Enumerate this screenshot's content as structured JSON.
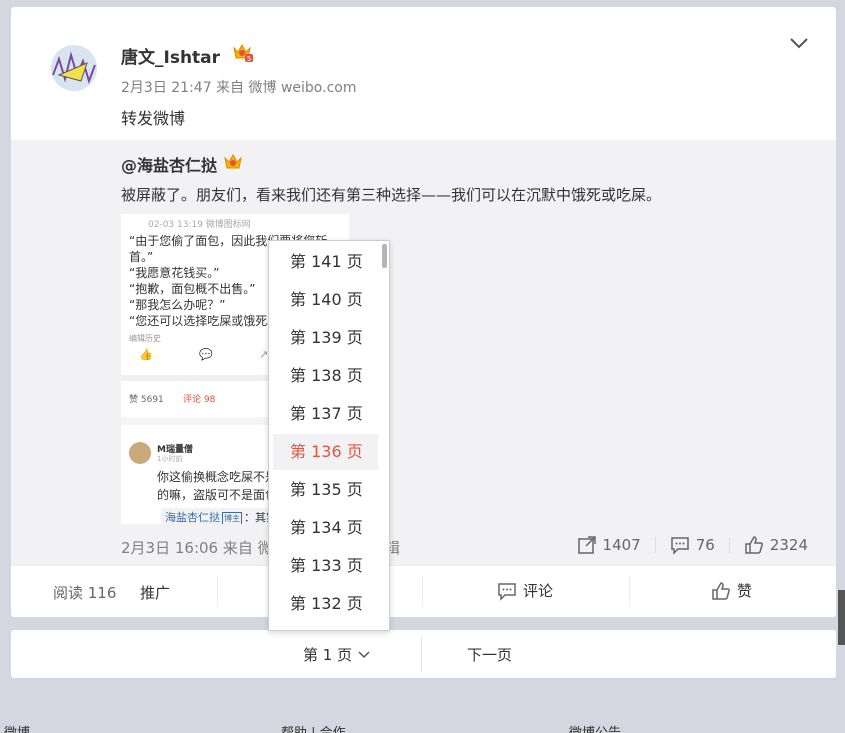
{
  "post": {
    "username": "唐文_Ishtar",
    "meta": "2月3日 21:47 来自 微博 weibo.com",
    "text": "转发微博"
  },
  "repost": {
    "username": "@海盐杏仁挞",
    "text": "被屏蔽了。朋友们，看来我们还有第三种选择——我们可以在沉默中饿死或吃屎。",
    "date": "2月3日 16:06 来自 微",
    "edit_suffix": "辑",
    "shares": "1407",
    "comments": "76",
    "likes": "2324",
    "image": {
      "date": "02-03 13:19  微博图标网",
      "lines": [
        "“由于您偷了面包，因此我们要将您斩",
        "首。”",
        "“我愿意花钱买。”",
        "“抱歉，面包概不出售。”",
        "“那我怎么办呢？”",
        "“您还可以选择吃屎或饿死。"
      ],
      "edit_history": "编辑历史",
      "likes_label": "赞 5691",
      "comments_label": "评论 98",
      "comment_user": "M瑞量僧",
      "comment_time": "1小时前",
      "comment_lines": [
        "你这偷换概念吃屎不是",
        "的嘛，盗版可不是面包"
      ],
      "quote_link": "海盐杏仁挞",
      "quote_tag": "博主",
      "quote_text": "：其实"
    }
  },
  "bottom": {
    "reads": "阅读 116",
    "promote": "推广",
    "comment": "评论",
    "like": "赞"
  },
  "pager": {
    "current": "第 1 页",
    "next": "下一页"
  },
  "dropdown": {
    "pages": [
      "第 141 页",
      "第 140 页",
      "第 139 页",
      "第 138 页",
      "第 137 页",
      "第 136 页",
      "第 135 页",
      "第 134 页",
      "第 133 页",
      "第 132 页"
    ],
    "selected_index": 5
  },
  "footer": {
    "a": "微博",
    "b": "帮助 | 合作",
    "c": "微博公告"
  },
  "colors": {
    "accent": "#e2543d",
    "link": "#3b6aa8",
    "page_bg": "#d4d6e0"
  }
}
